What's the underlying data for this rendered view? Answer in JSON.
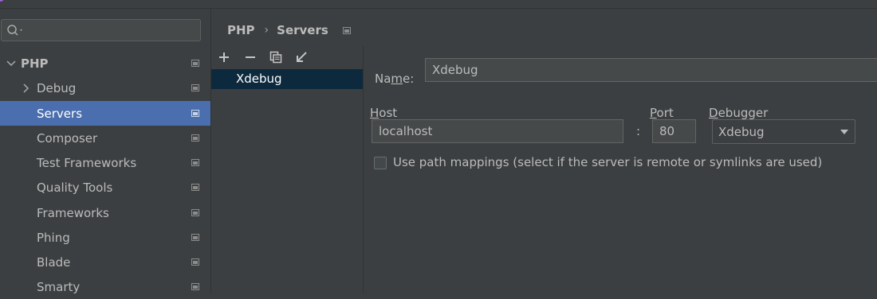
{
  "colors": {
    "selection": "#4b6eaf",
    "list_selection": "#0d293e",
    "background": "#3c3f41",
    "field": "#45494a"
  },
  "sidebar": {
    "search": {
      "placeholder": ""
    },
    "root": {
      "label": "PHP"
    },
    "items": [
      {
        "label": "Debug",
        "expandable": true
      },
      {
        "label": "Servers",
        "selected": true
      },
      {
        "label": "Composer"
      },
      {
        "label": "Test Frameworks"
      },
      {
        "label": "Quality Tools"
      },
      {
        "label": "Frameworks"
      },
      {
        "label": "Phing"
      },
      {
        "label": "Blade"
      },
      {
        "label": "Smarty"
      }
    ]
  },
  "breadcrumb": {
    "parent": "PHP",
    "separator": "›",
    "current": "Servers"
  },
  "toolbar": {
    "icons": [
      "add-icon",
      "remove-icon",
      "copy-icon",
      "import-icon"
    ]
  },
  "servers": {
    "items": [
      {
        "label": "Xdebug",
        "selected": true
      }
    ]
  },
  "form": {
    "name_label_pre": "Na",
    "name_label_mn": "m",
    "name_label_post": "e:",
    "name_value": "Xdebug",
    "host_label_mn": "H",
    "host_label_post": "ost",
    "host_value": "localhost",
    "colon": ":",
    "port_label_mn": "P",
    "port_label_post": "ort",
    "port_value": "80",
    "debugger_label_mn": "D",
    "debugger_label_post": "ebugger",
    "debugger_value": "Xdebug",
    "path_mappings_label": "Use path mappings (select if the server is remote or symlinks are used)",
    "path_mappings_checked": false
  }
}
